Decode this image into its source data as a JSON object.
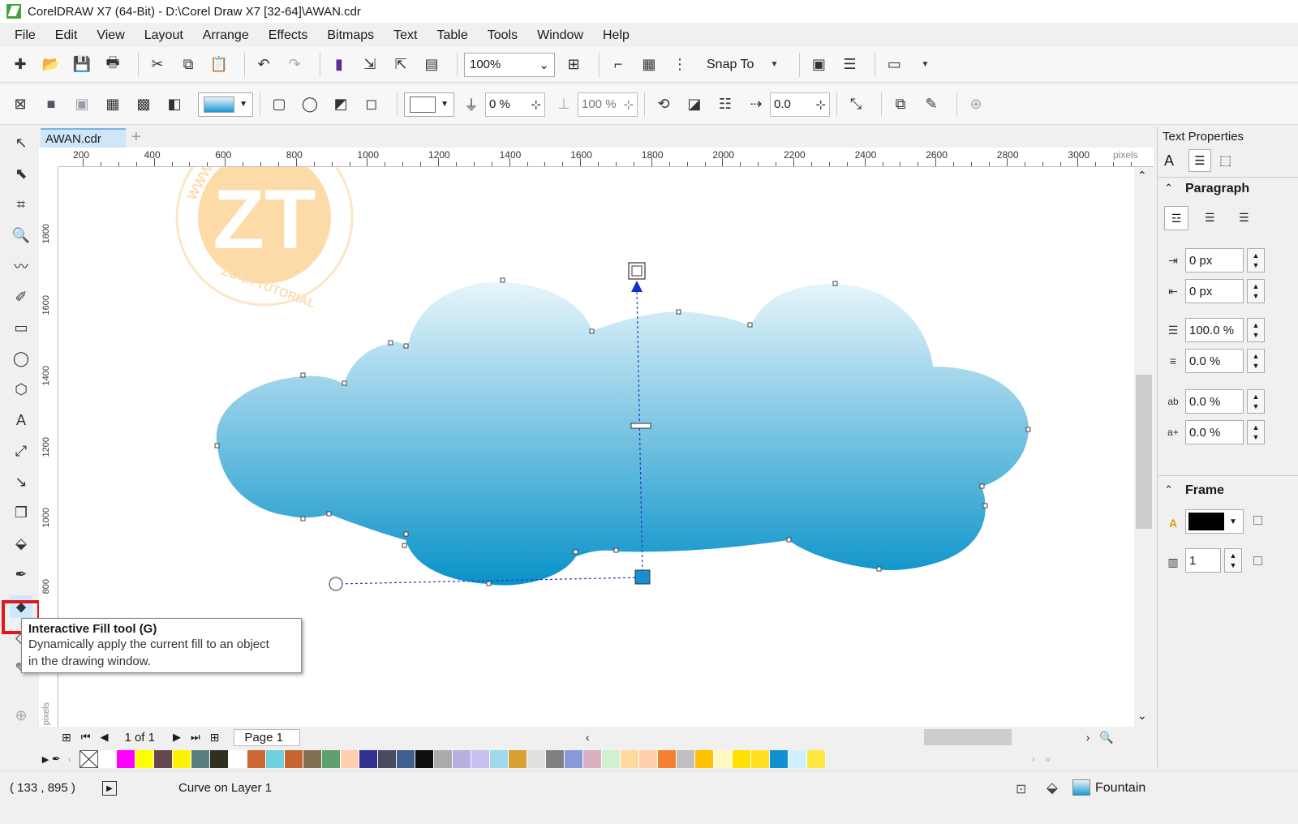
{
  "window": {
    "title": "CorelDRAW X7 (64-Bit) - D:\\Corel Draw X7 [32-64]\\AWAN.cdr"
  },
  "menu": [
    "File",
    "Edit",
    "View",
    "Layout",
    "Arrange",
    "Effects",
    "Bitmaps",
    "Text",
    "Table",
    "Tools",
    "Window",
    "Help"
  ],
  "toolbar": {
    "zoom_value": "100%",
    "snap_label": "Snap To"
  },
  "property_bar": {
    "transparency_value": "0 %",
    "midpoint_value": "100 %",
    "angle_value": "0.0"
  },
  "document_tab": {
    "label": "AWAN.cdr"
  },
  "ruler": {
    "top_labels": [
      "200",
      "400",
      "600",
      "800",
      "1000",
      "1200",
      "1400",
      "1600",
      "1800",
      "2000",
      "2200",
      "2400",
      "2600",
      "2800",
      "3000"
    ],
    "unit": "pixels",
    "left_labels": [
      "1800",
      "1600",
      "1400",
      "1200",
      "1000",
      "800"
    ],
    "left_unit": "pixels"
  },
  "watermark": {
    "monogram": "ZT",
    "ring_text": "WWW.ZOTUTORIAL.COM",
    "bottom_text": "ZONA TUTORIAL"
  },
  "page_nav": {
    "page_count": "1 of 1",
    "page_tab": "Page 1"
  },
  "palette_colors": [
    "#ffffff",
    "#ff00ff",
    "#ffff00",
    "#66474e",
    "#fff200",
    "#5b7f7f",
    "#303020",
    "#ffffff",
    "#cc6633",
    "#6fd0e0",
    "#c86430",
    "#807050",
    "#60a070",
    "#ffd0b0",
    "#303090",
    "#4a4a60",
    "#3f5f90",
    "#101010",
    "#aaaaaa",
    "#b8b0e0",
    "#c8c0f0",
    "#a0d8f0",
    "#d8a030",
    "#e0e0e0",
    "#808080",
    "#8898d8",
    "#d8b0c0",
    "#d0f0d0",
    "#ffd8a0",
    "#ffd0b0",
    "#f58030",
    "#c0c0c0",
    "#ffc000",
    "#fff8c0",
    "#ffe000",
    "#ffe020",
    "#1090d0",
    "#d0f0ff",
    "#ffe840"
  ],
  "status": {
    "coords": "( 133  , 895    )",
    "object_info": "Curve on Layer 1",
    "fill_label": "Fountain"
  },
  "docker": {
    "title": "Text Properties",
    "paragraph_label": "Paragraph",
    "left_indent": "0 px",
    "right_indent": "0 px",
    "line_spacing": "100.0 %",
    "para_spacing": "0.0 %",
    "char_spacing": "0.0 %",
    "word_spacing": "0.0 %",
    "frame_label": "Frame",
    "columns_value": "1"
  },
  "tooltip": {
    "title": "Interactive Fill tool (G)",
    "line1": "Dynamically apply the current fill to an object",
    "line2": "in the drawing window."
  },
  "colors": {
    "cloud_top": "#e8f5fb",
    "cloud_bottom": "#0892c9",
    "highlight": "#e0181e",
    "tab_bg": "#cfe5f9"
  }
}
